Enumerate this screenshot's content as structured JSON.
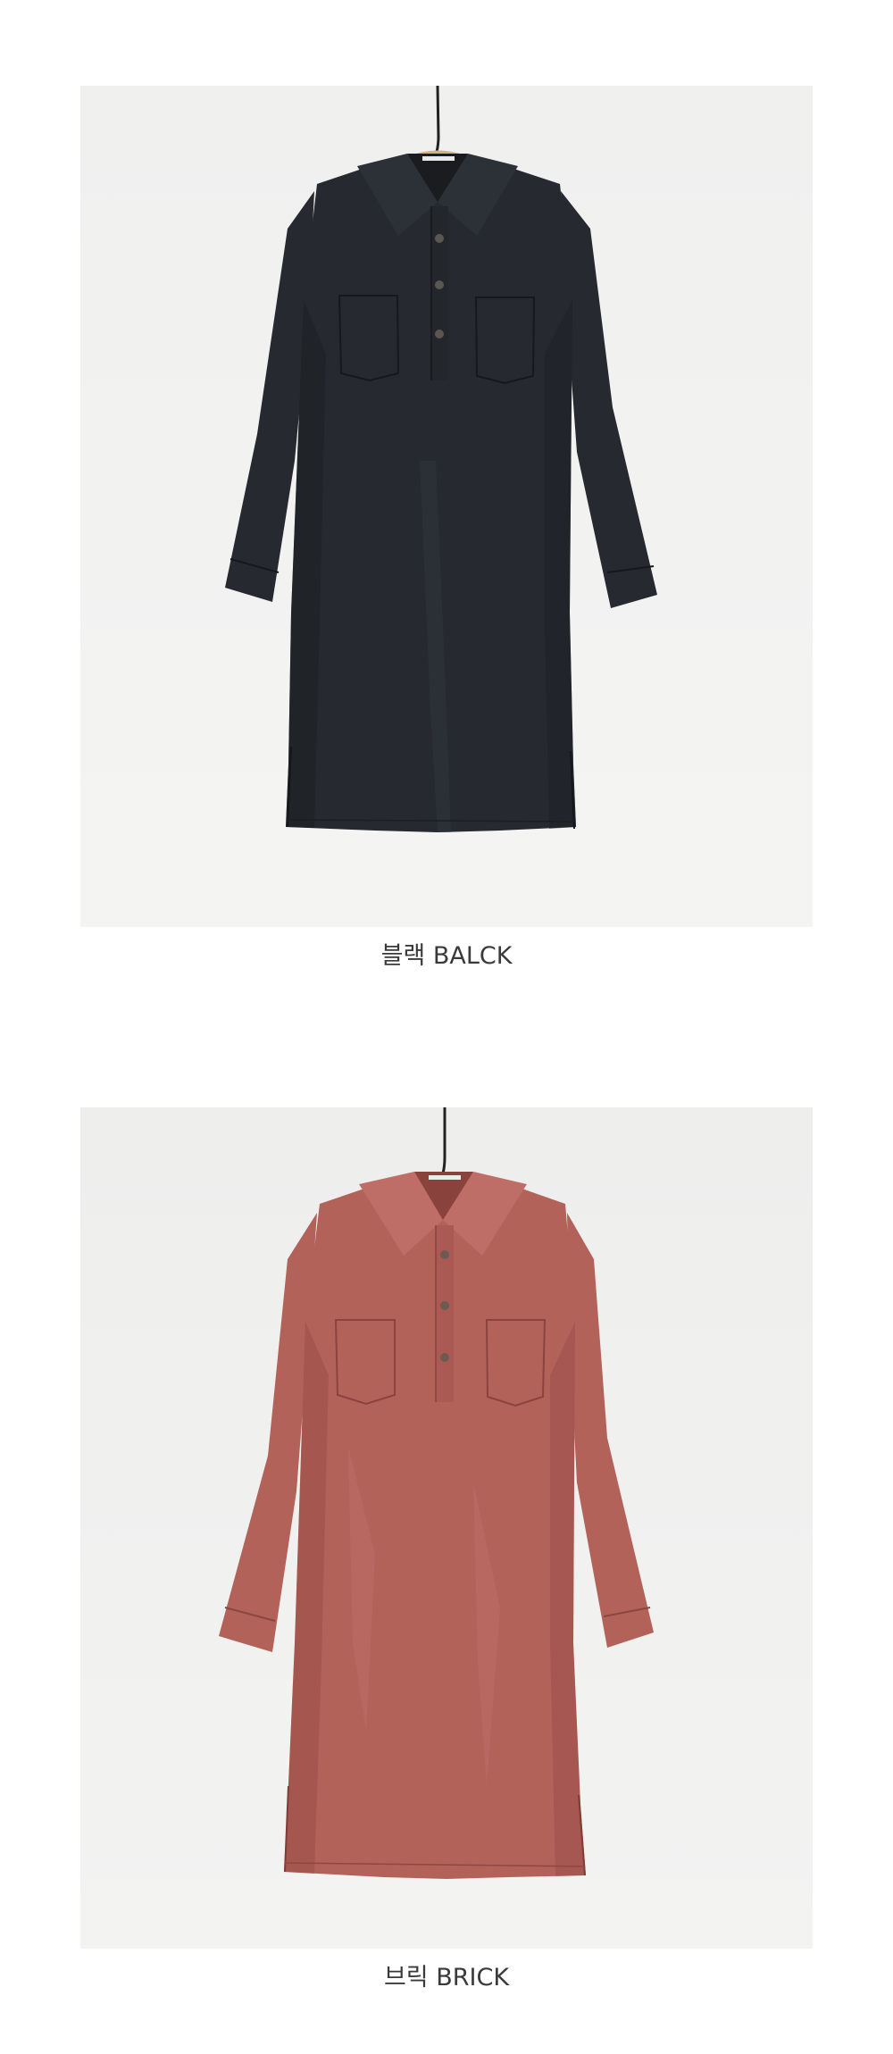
{
  "products": [
    {
      "id": "black",
      "caption": "블랙 BALCK",
      "garment_color": "#262a30",
      "garment_shade": "#1b1e23",
      "garment_highlight": "#363b42",
      "button_color": "#5a5752"
    },
    {
      "id": "brick",
      "caption": "브릭 BRICK",
      "garment_color": "#b3625a",
      "garment_shade": "#95494300",
      "garment_highlight": "#c27670",
      "button_color": "#6d5a52"
    }
  ],
  "hanger_color": "#d9ad7c",
  "hook_color": "#222222"
}
